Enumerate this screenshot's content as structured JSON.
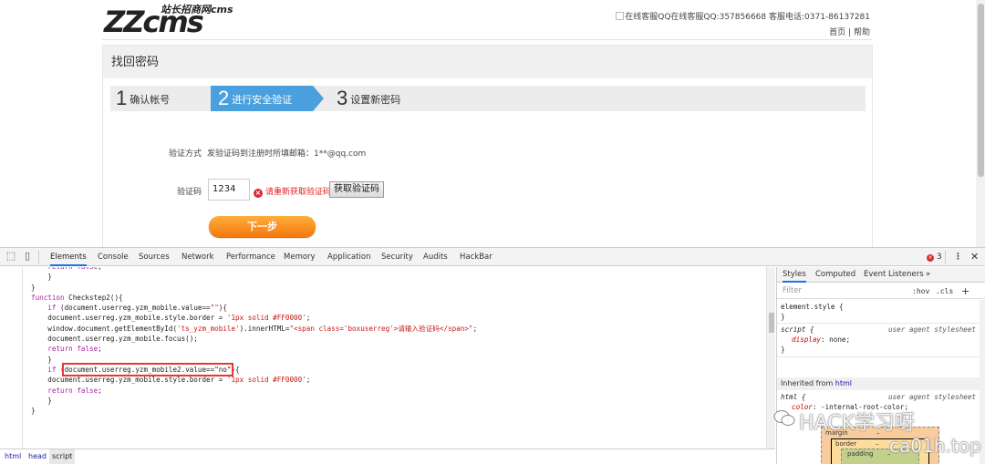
{
  "site": {
    "logo_big": "ZZcms",
    "logo_small": "站长招商网cms",
    "contact_line": "在线客服QQ在线客服QQ:357856668 客服电话:0371-86137281",
    "home_link": "首页",
    "help_link": "帮助",
    "link_sep": "|"
  },
  "panel": {
    "title": "找回密码",
    "steps": [
      {
        "num": "1",
        "label": "确认帐号"
      },
      {
        "num": "2",
        "label": "进行安全验证"
      },
      {
        "num": "3",
        "label": "设置新密码"
      }
    ],
    "method_label": "验证方式",
    "method_value": "发验证码到注册时所填邮箱：1**@qq.com",
    "code_label": "验证码",
    "code_value": "1234",
    "error_text": "请重新获取验证码",
    "error_icon": "x-circle-icon",
    "get_code_button": "获取验证码",
    "next_button": "下一步"
  },
  "devtools": {
    "tabs": [
      "Elements",
      "Console",
      "Sources",
      "Network",
      "Performance",
      "Memory",
      "Application",
      "Security",
      "Audits",
      "HackBar"
    ],
    "active_tab": "Elements",
    "error_count": "3",
    "code_lines": [
      "    return false;",
      "    }",
      "}",
      "",
      "",
      "function Checkstep2(){",
      "    if (document.userreg.yzm_mobile.value==\"\"){",
      "    document.userreg.yzm_mobile.style.border = '1px solid #FF0000';",
      "    window.document.getElementById('ts_yzm_mobile').innerHTML=\"<span class='boxuserreg'>请输入验证码</span>\";",
      "    document.userreg.yzm_mobile.focus();",
      "    return false;",
      "    }",
      "    if (document.userreg.yzm_mobile2.value==\"no\"){",
      "    document.userreg.yzm_mobile.style.border = '1px solid #FF0000';",
      "    return false;",
      "    }",
      "}"
    ],
    "highlight_text": "document.userreg.yzm_mobile2.value==\"no\"",
    "breadcrumbs": [
      "html",
      "head",
      "script"
    ],
    "side_tabs": [
      "Styles",
      "Computed",
      "Event Listeners",
      "»"
    ],
    "filter_placeholder": "Filter",
    "filter_hov": ":hov",
    "filter_cls": ".cls",
    "filter_plus": "+",
    "rules": {
      "element_style": "element.style {",
      "close": "}",
      "script_sel": "script {",
      "script_src": "user agent stylesheet",
      "script_prop": "display",
      "script_val": "none;",
      "inherited_label": "Inherited from",
      "inherited_el": "html",
      "html_sel": "html {",
      "html_src": "user agent stylesheet",
      "html_prop": "color",
      "html_val": "-internal-root-color;"
    },
    "box_model": {
      "margin": "margin",
      "border": "border",
      "padding": "padding",
      "dash": "–"
    }
  },
  "watermark": {
    "line1": "HACK学习呀",
    "line2": "ca01h.top"
  },
  "colors": {
    "step_active": "#4aa0dc",
    "next_btn": "#f5780d",
    "error": "#e02020",
    "highlight_box": "#e53935",
    "devtools_active_tab": "#1a73e8"
  }
}
